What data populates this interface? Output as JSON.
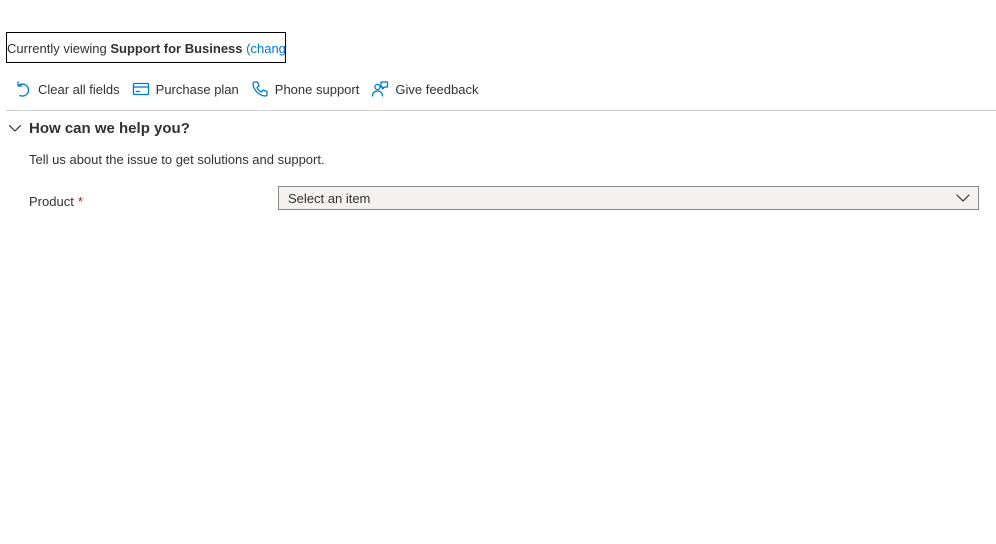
{
  "viewing": {
    "prefix": "Currently viewing",
    "product": "Support for Business",
    "open_paren": "(",
    "change_label": "change",
    "close_paren": ")"
  },
  "toolbar": {
    "items": [
      {
        "label": "Clear all fields",
        "icon": "undo-icon"
      },
      {
        "label": "Purchase plan",
        "icon": "credit-card-icon"
      },
      {
        "label": "Phone support",
        "icon": "phone-icon"
      },
      {
        "label": "Give feedback",
        "icon": "feedback-icon"
      }
    ]
  },
  "section": {
    "title": "How can we help you?",
    "expanded": true,
    "description": "Tell us about the issue to get solutions and support."
  },
  "product_field": {
    "label": "Product",
    "required_mark": "*",
    "placeholder": "Select an item"
  },
  "colors": {
    "accent": "#0078d4",
    "text": "#323130",
    "required": "#a4262c",
    "divider": "#d2d0ce",
    "field_bg": "#f3f2f1"
  }
}
